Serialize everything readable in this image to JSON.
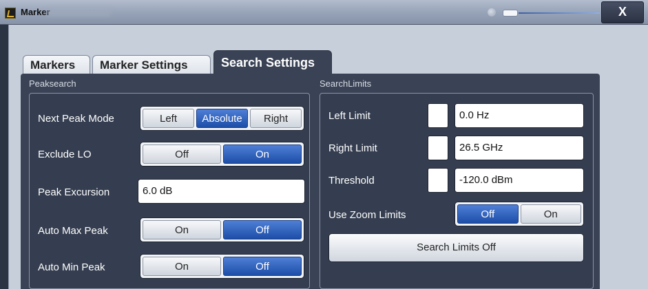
{
  "window": {
    "title": "Marker",
    "close_label": "X"
  },
  "tabs": [
    {
      "label": "Markers",
      "active": false
    },
    {
      "label": "Marker Settings",
      "active": false
    },
    {
      "label": "Search Settings",
      "active": true
    }
  ],
  "peaksearch": {
    "group_title": "Peaksearch",
    "next_peak_mode": {
      "label": "Next Peak Mode",
      "options": [
        "Left",
        "Absolute",
        "Right"
      ],
      "selected": "Absolute"
    },
    "exclude_lo": {
      "label": "Exclude LO",
      "options": [
        "Off",
        "On"
      ],
      "selected": "On"
    },
    "peak_excursion": {
      "label": "Peak Excursion",
      "value": "6.0 dB"
    },
    "auto_max_peak": {
      "label": "Auto Max Peak",
      "options": [
        "On",
        "Off"
      ],
      "selected": "Off"
    },
    "auto_min_peak": {
      "label": "Auto Min Peak",
      "options": [
        "On",
        "Off"
      ],
      "selected": "Off"
    }
  },
  "search_limits": {
    "group_title": "SearchLimits",
    "left_limit": {
      "label": "Left Limit",
      "value": "0.0 Hz"
    },
    "right_limit": {
      "label": "Right Limit",
      "value": "26.5 GHz"
    },
    "threshold": {
      "label": "Threshold",
      "value": "-120.0 dBm"
    },
    "use_zoom_limits": {
      "label": "Use Zoom Limits",
      "options": [
        "Off",
        "On"
      ],
      "selected": "Off"
    },
    "search_limits_off_button": "Search Limits Off"
  },
  "colors": {
    "panel_bg": "#3a4355",
    "selected_option": "#2b5fc0",
    "dialog_bg": "#c7cfdb"
  }
}
